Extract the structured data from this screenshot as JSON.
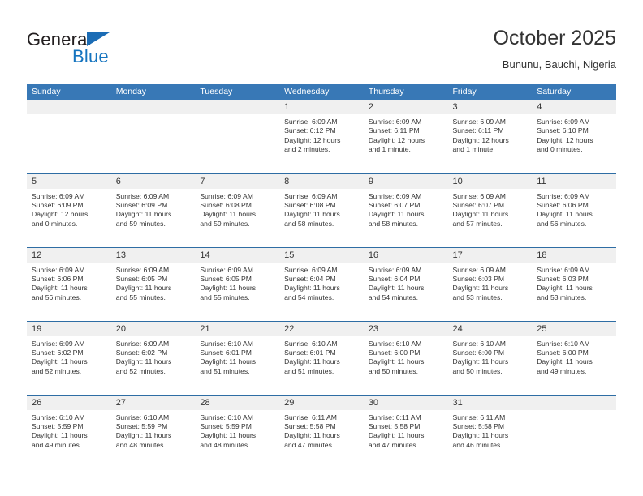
{
  "logo": {
    "part1": "General",
    "part2": "Blue",
    "triangle_color": "#1b6cb5",
    "blue_color": "#1574bf"
  },
  "header": {
    "title": "October 2025",
    "subtitle": "Bununu, Bauchi, Nigeria"
  },
  "theme": {
    "header_blue": "#3878b6",
    "row_divider_blue": "#2e6da4",
    "day_band_gray": "#f0f0f0"
  },
  "weekdays": [
    "Sunday",
    "Monday",
    "Tuesday",
    "Wednesday",
    "Thursday",
    "Friday",
    "Saturday"
  ],
  "weeks": [
    [
      {
        "day": "",
        "sunrise": "",
        "sunset": "",
        "daylight1": "",
        "daylight2": "",
        "empty": true
      },
      {
        "day": "",
        "sunrise": "",
        "sunset": "",
        "daylight1": "",
        "daylight2": "",
        "empty": true
      },
      {
        "day": "",
        "sunrise": "",
        "sunset": "",
        "daylight1": "",
        "daylight2": "",
        "empty": true
      },
      {
        "day": "1",
        "sunrise": "Sunrise: 6:09 AM",
        "sunset": "Sunset: 6:12 PM",
        "daylight1": "Daylight: 12 hours",
        "daylight2": "and 2 minutes.",
        "empty": false
      },
      {
        "day": "2",
        "sunrise": "Sunrise: 6:09 AM",
        "sunset": "Sunset: 6:11 PM",
        "daylight1": "Daylight: 12 hours",
        "daylight2": "and 1 minute.",
        "empty": false
      },
      {
        "day": "3",
        "sunrise": "Sunrise: 6:09 AM",
        "sunset": "Sunset: 6:11 PM",
        "daylight1": "Daylight: 12 hours",
        "daylight2": "and 1 minute.",
        "empty": false
      },
      {
        "day": "4",
        "sunrise": "Sunrise: 6:09 AM",
        "sunset": "Sunset: 6:10 PM",
        "daylight1": "Daylight: 12 hours",
        "daylight2": "and 0 minutes.",
        "empty": false
      }
    ],
    [
      {
        "day": "5",
        "sunrise": "Sunrise: 6:09 AM",
        "sunset": "Sunset: 6:09 PM",
        "daylight1": "Daylight: 12 hours",
        "daylight2": "and 0 minutes.",
        "empty": false
      },
      {
        "day": "6",
        "sunrise": "Sunrise: 6:09 AM",
        "sunset": "Sunset: 6:09 PM",
        "daylight1": "Daylight: 11 hours",
        "daylight2": "and 59 minutes.",
        "empty": false
      },
      {
        "day": "7",
        "sunrise": "Sunrise: 6:09 AM",
        "sunset": "Sunset: 6:08 PM",
        "daylight1": "Daylight: 11 hours",
        "daylight2": "and 59 minutes.",
        "empty": false
      },
      {
        "day": "8",
        "sunrise": "Sunrise: 6:09 AM",
        "sunset": "Sunset: 6:08 PM",
        "daylight1": "Daylight: 11 hours",
        "daylight2": "and 58 minutes.",
        "empty": false
      },
      {
        "day": "9",
        "sunrise": "Sunrise: 6:09 AM",
        "sunset": "Sunset: 6:07 PM",
        "daylight1": "Daylight: 11 hours",
        "daylight2": "and 58 minutes.",
        "empty": false
      },
      {
        "day": "10",
        "sunrise": "Sunrise: 6:09 AM",
        "sunset": "Sunset: 6:07 PM",
        "daylight1": "Daylight: 11 hours",
        "daylight2": "and 57 minutes.",
        "empty": false
      },
      {
        "day": "11",
        "sunrise": "Sunrise: 6:09 AM",
        "sunset": "Sunset: 6:06 PM",
        "daylight1": "Daylight: 11 hours",
        "daylight2": "and 56 minutes.",
        "empty": false
      }
    ],
    [
      {
        "day": "12",
        "sunrise": "Sunrise: 6:09 AM",
        "sunset": "Sunset: 6:06 PM",
        "daylight1": "Daylight: 11 hours",
        "daylight2": "and 56 minutes.",
        "empty": false
      },
      {
        "day": "13",
        "sunrise": "Sunrise: 6:09 AM",
        "sunset": "Sunset: 6:05 PM",
        "daylight1": "Daylight: 11 hours",
        "daylight2": "and 55 minutes.",
        "empty": false
      },
      {
        "day": "14",
        "sunrise": "Sunrise: 6:09 AM",
        "sunset": "Sunset: 6:05 PM",
        "daylight1": "Daylight: 11 hours",
        "daylight2": "and 55 minutes.",
        "empty": false
      },
      {
        "day": "15",
        "sunrise": "Sunrise: 6:09 AM",
        "sunset": "Sunset: 6:04 PM",
        "daylight1": "Daylight: 11 hours",
        "daylight2": "and 54 minutes.",
        "empty": false
      },
      {
        "day": "16",
        "sunrise": "Sunrise: 6:09 AM",
        "sunset": "Sunset: 6:04 PM",
        "daylight1": "Daylight: 11 hours",
        "daylight2": "and 54 minutes.",
        "empty": false
      },
      {
        "day": "17",
        "sunrise": "Sunrise: 6:09 AM",
        "sunset": "Sunset: 6:03 PM",
        "daylight1": "Daylight: 11 hours",
        "daylight2": "and 53 minutes.",
        "empty": false
      },
      {
        "day": "18",
        "sunrise": "Sunrise: 6:09 AM",
        "sunset": "Sunset: 6:03 PM",
        "daylight1": "Daylight: 11 hours",
        "daylight2": "and 53 minutes.",
        "empty": false
      }
    ],
    [
      {
        "day": "19",
        "sunrise": "Sunrise: 6:09 AM",
        "sunset": "Sunset: 6:02 PM",
        "daylight1": "Daylight: 11 hours",
        "daylight2": "and 52 minutes.",
        "empty": false
      },
      {
        "day": "20",
        "sunrise": "Sunrise: 6:09 AM",
        "sunset": "Sunset: 6:02 PM",
        "daylight1": "Daylight: 11 hours",
        "daylight2": "and 52 minutes.",
        "empty": false
      },
      {
        "day": "21",
        "sunrise": "Sunrise: 6:10 AM",
        "sunset": "Sunset: 6:01 PM",
        "daylight1": "Daylight: 11 hours",
        "daylight2": "and 51 minutes.",
        "empty": false
      },
      {
        "day": "22",
        "sunrise": "Sunrise: 6:10 AM",
        "sunset": "Sunset: 6:01 PM",
        "daylight1": "Daylight: 11 hours",
        "daylight2": "and 51 minutes.",
        "empty": false
      },
      {
        "day": "23",
        "sunrise": "Sunrise: 6:10 AM",
        "sunset": "Sunset: 6:00 PM",
        "daylight1": "Daylight: 11 hours",
        "daylight2": "and 50 minutes.",
        "empty": false
      },
      {
        "day": "24",
        "sunrise": "Sunrise: 6:10 AM",
        "sunset": "Sunset: 6:00 PM",
        "daylight1": "Daylight: 11 hours",
        "daylight2": "and 50 minutes.",
        "empty": false
      },
      {
        "day": "25",
        "sunrise": "Sunrise: 6:10 AM",
        "sunset": "Sunset: 6:00 PM",
        "daylight1": "Daylight: 11 hours",
        "daylight2": "and 49 minutes.",
        "empty": false
      }
    ],
    [
      {
        "day": "26",
        "sunrise": "Sunrise: 6:10 AM",
        "sunset": "Sunset: 5:59 PM",
        "daylight1": "Daylight: 11 hours",
        "daylight2": "and 49 minutes.",
        "empty": false
      },
      {
        "day": "27",
        "sunrise": "Sunrise: 6:10 AM",
        "sunset": "Sunset: 5:59 PM",
        "daylight1": "Daylight: 11 hours",
        "daylight2": "and 48 minutes.",
        "empty": false
      },
      {
        "day": "28",
        "sunrise": "Sunrise: 6:10 AM",
        "sunset": "Sunset: 5:59 PM",
        "daylight1": "Daylight: 11 hours",
        "daylight2": "and 48 minutes.",
        "empty": false
      },
      {
        "day": "29",
        "sunrise": "Sunrise: 6:11 AM",
        "sunset": "Sunset: 5:58 PM",
        "daylight1": "Daylight: 11 hours",
        "daylight2": "and 47 minutes.",
        "empty": false
      },
      {
        "day": "30",
        "sunrise": "Sunrise: 6:11 AM",
        "sunset": "Sunset: 5:58 PM",
        "daylight1": "Daylight: 11 hours",
        "daylight2": "and 47 minutes.",
        "empty": false
      },
      {
        "day": "31",
        "sunrise": "Sunrise: 6:11 AM",
        "sunset": "Sunset: 5:58 PM",
        "daylight1": "Daylight: 11 hours",
        "daylight2": "and 46 minutes.",
        "empty": false
      },
      {
        "day": "",
        "sunrise": "",
        "sunset": "",
        "daylight1": "",
        "daylight2": "",
        "empty": true
      }
    ]
  ]
}
